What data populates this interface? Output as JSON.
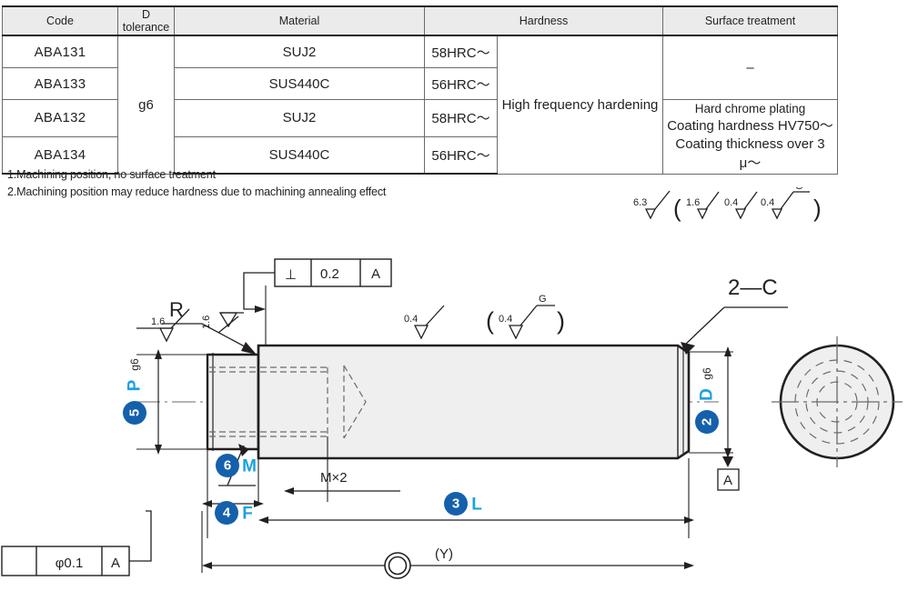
{
  "table": {
    "headers": [
      "Code",
      "D tolerance",
      "Material",
      "Hardness",
      "Surface treatment"
    ],
    "rows": [
      {
        "code": "ABA131",
        "material": "SUJ2",
        "hrc": "58HRC〜"
      },
      {
        "code": "ABA133",
        "material": "SUS440C",
        "hrc": "56HRC〜"
      },
      {
        "code": "ABA132",
        "material": "SUJ2",
        "hrc": "58HRC〜"
      },
      {
        "code": "ABA134",
        "material": "SUS440C",
        "hrc": "56HRC〜"
      }
    ],
    "d_tolerance": "g6",
    "hardness_merged": "High frequency hardening",
    "surface_none": "–",
    "surface_plating_line1": "Hard chrome plating",
    "surface_plating_line2": "Coating hardness HV750〜",
    "surface_plating_line3": "Coating thickness over 3 μ〜"
  },
  "notes": [
    "1.Machining position, no surface treatment",
    "2.Machining position may reduce hardness due to machining annealing effect"
  ],
  "roughness_header": {
    "primary": "6.3",
    "open_paren": "(",
    "second": "1.6",
    "third": "0.4",
    "fourth": "0.4",
    "grind_mark": "G",
    "close_paren": ")"
  },
  "drawing": {
    "tolerance_frame_top": {
      "symbol": "⊥",
      "value": "0.2",
      "datum": "A"
    },
    "tolerance_frame_bottom": {
      "symbol": "",
      "value": "φ0.1",
      "datum": "A"
    },
    "datum_label_right": "A",
    "callout_radius": "R",
    "callout_chamfer": "2—C",
    "thread_note": "M×2",
    "rough_left": "1.6",
    "rough_step": "1.6",
    "rough_shaft": "0.4",
    "rough_shaft_paren_open": "(",
    "rough_shaft_paren_value": "0.4",
    "rough_shaft_paren_grind": "G",
    "rough_shaft_paren_close": ")",
    "dim_p": {
      "num": "5",
      "letter": "P",
      "suffix": "g6"
    },
    "dim_d": {
      "num": "2",
      "letter": "D",
      "suffix": "g6"
    },
    "dim_m": {
      "num": "6",
      "letter": "M"
    },
    "dim_f": {
      "num": "4",
      "letter": "F"
    },
    "dim_l": {
      "num": "3",
      "letter": "L"
    },
    "dim_y": "(Y)"
  }
}
